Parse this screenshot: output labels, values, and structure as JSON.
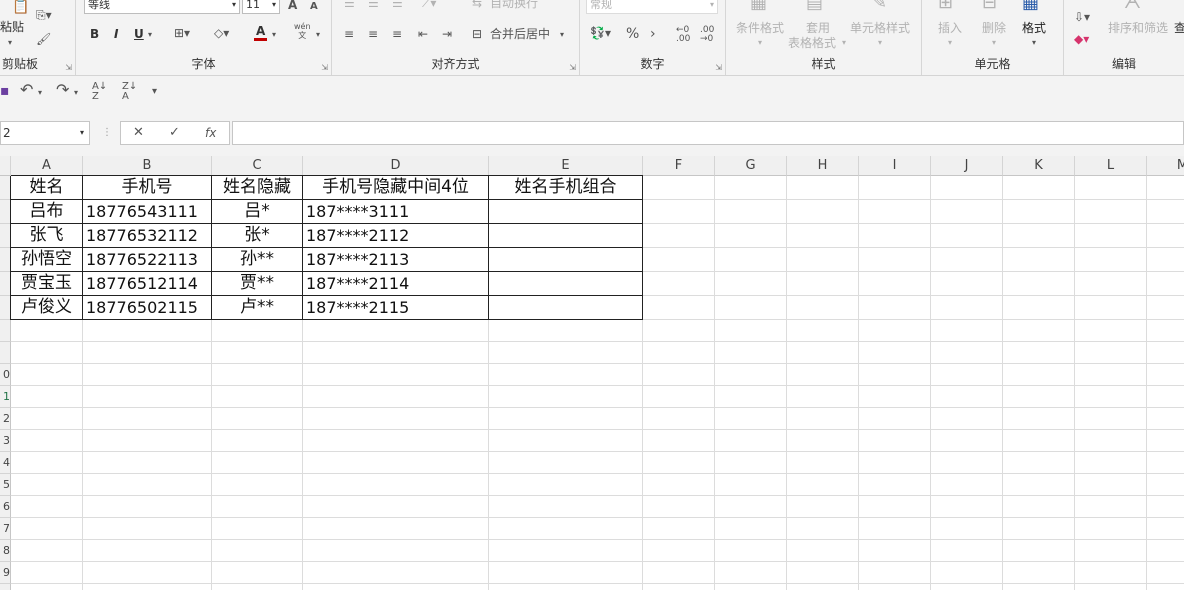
{
  "ribbon": {
    "clipboard": {
      "paste": "粘贴",
      "group": "剪贴板"
    },
    "font": {
      "name": "等线",
      "size": "11",
      "group": "字体",
      "bold": "B",
      "italic": "I",
      "underline": "U",
      "grow": "A",
      "shrink": "A",
      "font_color": "A",
      "phonetic_top": "wén",
      "phonetic_bottom": "文"
    },
    "alignment": {
      "wrap_text": "自动换行",
      "merge_center": "合并后居中",
      "group": "对齐方式"
    },
    "number": {
      "format": "常规",
      "percent": "%",
      "comma": "›",
      "group": "数字"
    },
    "styles": {
      "conditional": "条件格式",
      "table_top": "套用",
      "table_bottom": "表格格式",
      "cell_styles": "单元格样式",
      "group": "样式"
    },
    "cells": {
      "insert": "插入",
      "delete": "删除",
      "format": "格式",
      "group": "单元格"
    },
    "editing": {
      "sort_filter": "排序和筛选",
      "find": "查",
      "group": "编辑"
    }
  },
  "qat": {
    "more": "▾"
  },
  "formula_bar": {
    "name_box": "2",
    "cancel": "✕",
    "enter": "✓",
    "fx": "fx",
    "formula": ""
  },
  "sheet": {
    "columns": [
      "A",
      "B",
      "C",
      "D",
      "E",
      "F",
      "G",
      "H",
      "I",
      "J",
      "K",
      "L",
      "M"
    ],
    "row_labels": [
      "",
      "",
      "",
      "",
      "",
      "",
      "",
      "",
      "0",
      "1",
      "2",
      "3",
      "4",
      "5",
      "6",
      "7",
      "8",
      "9",
      "0"
    ],
    "header_row": [
      "姓名",
      "手机号",
      "姓名隐藏",
      "手机号隐藏中间4位",
      "姓名手机组合"
    ],
    "rows": [
      [
        "吕布",
        "18776543111",
        "吕*",
        "187****3111",
        ""
      ],
      [
        "张飞",
        "18776532112",
        "张*",
        "187****2112",
        ""
      ],
      [
        "孙悟空",
        "18776522113",
        "孙**",
        "187****2113",
        ""
      ],
      [
        "贾宝玉",
        "18776512114",
        "贾**",
        "187****2114",
        ""
      ],
      [
        "卢俊义",
        "18776502115",
        "卢**",
        "187****2115",
        ""
      ]
    ]
  },
  "colors": {
    "ribbon_bg": "#f3f3f3",
    "grid_line": "#dcdcdc",
    "table_border": "#222222",
    "font_red": "#c00000",
    "active_row": "#217346"
  }
}
